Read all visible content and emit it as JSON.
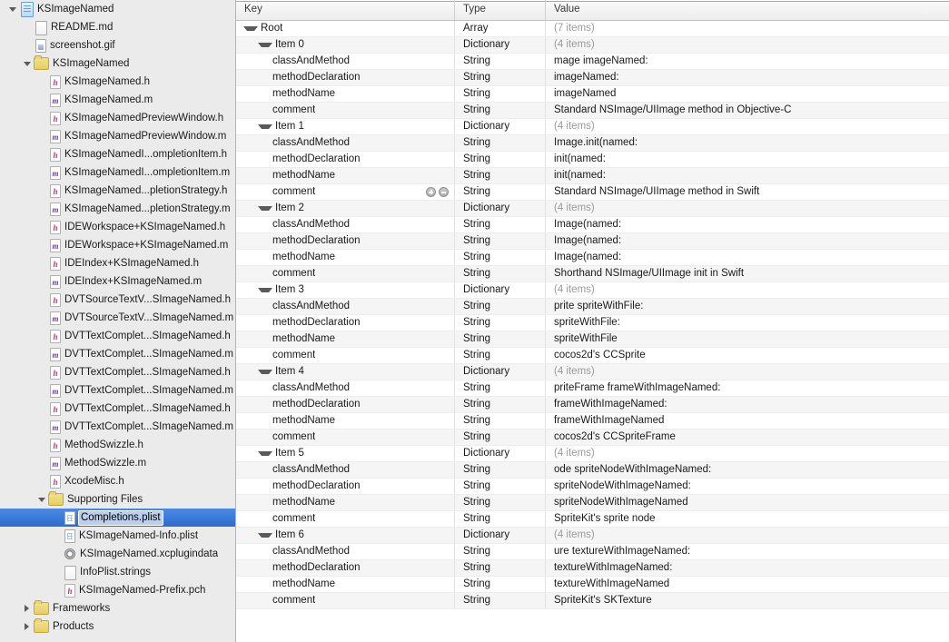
{
  "sidebar": {
    "name": "project-navigator",
    "rows": [
      {
        "label": "KSImageNamed",
        "icon": "project-icon",
        "indent": 0,
        "disclosure": "open",
        "selected": false
      },
      {
        "label": "README.md",
        "icon": "document-icon",
        "indent": 1,
        "disclosure": "none",
        "selected": false
      },
      {
        "label": "screenshot.gif",
        "icon": "image-icon",
        "indent": 1,
        "disclosure": "none",
        "selected": false
      },
      {
        "label": "KSImageNamed",
        "icon": "folder-icon",
        "indent": 1,
        "disclosure": "open",
        "selected": false
      },
      {
        "label": "KSImageNamed.h",
        "icon": "header-file-icon",
        "indent": 2,
        "disclosure": "none",
        "selected": false
      },
      {
        "label": "KSImageNamed.m",
        "icon": "method-file-icon",
        "indent": 2,
        "disclosure": "none",
        "selected": false
      },
      {
        "label": "KSImageNamedPreviewWindow.h",
        "icon": "header-file-icon",
        "indent": 2,
        "disclosure": "none",
        "selected": false
      },
      {
        "label": "KSImageNamedPreviewWindow.m",
        "icon": "method-file-icon",
        "indent": 2,
        "disclosure": "none",
        "selected": false
      },
      {
        "label": "KSImageNamedI...ompletionItem.h",
        "icon": "header-file-icon",
        "indent": 2,
        "disclosure": "none",
        "selected": false
      },
      {
        "label": "KSImageNamedI...ompletionItem.m",
        "icon": "method-file-icon",
        "indent": 2,
        "disclosure": "none",
        "selected": false
      },
      {
        "label": "KSImageNamed...pletionStrategy.h",
        "icon": "header-file-icon",
        "indent": 2,
        "disclosure": "none",
        "selected": false
      },
      {
        "label": "KSImageNamed...pletionStrategy.m",
        "icon": "method-file-icon",
        "indent": 2,
        "disclosure": "none",
        "selected": false
      },
      {
        "label": "IDEWorkspace+KSImageNamed.h",
        "icon": "header-file-icon",
        "indent": 2,
        "disclosure": "none",
        "selected": false
      },
      {
        "label": "IDEWorkspace+KSImageNamed.m",
        "icon": "method-file-icon",
        "indent": 2,
        "disclosure": "none",
        "selected": false
      },
      {
        "label": "IDEIndex+KSImageNamed.h",
        "icon": "header-file-icon",
        "indent": 2,
        "disclosure": "none",
        "selected": false
      },
      {
        "label": "IDEIndex+KSImageNamed.m",
        "icon": "method-file-icon",
        "indent": 2,
        "disclosure": "none",
        "selected": false
      },
      {
        "label": "DVTSourceTextV...SImageNamed.h",
        "icon": "header-file-icon",
        "indent": 2,
        "disclosure": "none",
        "selected": false
      },
      {
        "label": "DVTSourceTextV...SImageNamed.m",
        "icon": "method-file-icon",
        "indent": 2,
        "disclosure": "none",
        "selected": false
      },
      {
        "label": "DVTTextComplet...SImageNamed.h",
        "icon": "header-file-icon",
        "indent": 2,
        "disclosure": "none",
        "selected": false
      },
      {
        "label": "DVTTextComplet...SImageNamed.m",
        "icon": "method-file-icon",
        "indent": 2,
        "disclosure": "none",
        "selected": false
      },
      {
        "label": "DVTTextComplet...SImageNamed.h",
        "icon": "header-file-icon",
        "indent": 2,
        "disclosure": "none",
        "selected": false
      },
      {
        "label": "DVTTextComplet...SImageNamed.m",
        "icon": "method-file-icon",
        "indent": 2,
        "disclosure": "none",
        "selected": false
      },
      {
        "label": "DVTTextComplet...SImageNamed.h",
        "icon": "header-file-icon",
        "indent": 2,
        "disclosure": "none",
        "selected": false
      },
      {
        "label": "DVTTextComplet...SImageNamed.m",
        "icon": "method-file-icon",
        "indent": 2,
        "disclosure": "none",
        "selected": false
      },
      {
        "label": "MethodSwizzle.h",
        "icon": "header-file-icon",
        "indent": 2,
        "disclosure": "none",
        "selected": false
      },
      {
        "label": "MethodSwizzle.m",
        "icon": "method-file-icon",
        "indent": 2,
        "disclosure": "none",
        "selected": false
      },
      {
        "label": "XcodeMisc.h",
        "icon": "header-file-icon",
        "indent": 2,
        "disclosure": "none",
        "selected": false
      },
      {
        "label": "Supporting Files",
        "icon": "folder-icon",
        "indent": 2,
        "disclosure": "open",
        "selected": false
      },
      {
        "label": "Completions.plist",
        "icon": "plist-icon",
        "indent": 3,
        "disclosure": "none",
        "selected": true
      },
      {
        "label": "KSImageNamed-Info.plist",
        "icon": "plist-icon",
        "indent": 3,
        "disclosure": "none",
        "selected": false
      },
      {
        "label": "KSImageNamed.xcplugindata",
        "icon": "gear-icon",
        "indent": 3,
        "disclosure": "none",
        "selected": false
      },
      {
        "label": "InfoPlist.strings",
        "icon": "document-icon",
        "indent": 3,
        "disclosure": "none",
        "selected": false
      },
      {
        "label": "KSImageNamed-Prefix.pch",
        "icon": "header-file-icon",
        "indent": 3,
        "disclosure": "none",
        "selected": false
      },
      {
        "label": "Frameworks",
        "icon": "folder-icon",
        "indent": 1,
        "disclosure": "closed",
        "selected": false
      },
      {
        "label": "Products",
        "icon": "folder-icon",
        "indent": 1,
        "disclosure": "closed",
        "selected": false
      }
    ]
  },
  "editor": {
    "name": "plist-editor",
    "columns": {
      "key": "Key",
      "type": "Type",
      "value": "Value"
    },
    "rows": [
      {
        "key": "Root",
        "indent": 0,
        "disclosure": "open",
        "type": "Array",
        "value": "(7 items)",
        "muted": true,
        "buttons": false
      },
      {
        "key": "Item 0",
        "indent": 1,
        "disclosure": "open",
        "type": "Dictionary",
        "value": "(4 items)",
        "muted": true,
        "buttons": false
      },
      {
        "key": "classAndMethod",
        "indent": 2,
        "disclosure": "none",
        "type": "String",
        "value": "mage imageNamed:",
        "muted": false,
        "buttons": false
      },
      {
        "key": "methodDeclaration",
        "indent": 2,
        "disclosure": "none",
        "type": "String",
        "value": " imageNamed:",
        "muted": false,
        "buttons": false
      },
      {
        "key": "methodName",
        "indent": 2,
        "disclosure": "none",
        "type": "String",
        "value": "imageNamed",
        "muted": false,
        "buttons": false
      },
      {
        "key": "comment",
        "indent": 2,
        "disclosure": "none",
        "type": "String",
        "value": "Standard NSImage/UIImage method in Objective-C",
        "muted": false,
        "buttons": false
      },
      {
        "key": "Item 1",
        "indent": 1,
        "disclosure": "open",
        "type": "Dictionary",
        "value": "(4 items)",
        "muted": true,
        "buttons": false
      },
      {
        "key": "classAndMethod",
        "indent": 2,
        "disclosure": "none",
        "type": "String",
        "value": "Image.init(named:",
        "muted": false,
        "buttons": false
      },
      {
        "key": "methodDeclaration",
        "indent": 2,
        "disclosure": "none",
        "type": "String",
        "value": " init(named:",
        "muted": false,
        "buttons": false
      },
      {
        "key": "methodName",
        "indent": 2,
        "disclosure": "none",
        "type": "String",
        "value": "init(named:",
        "muted": false,
        "buttons": false
      },
      {
        "key": "comment",
        "indent": 2,
        "disclosure": "none",
        "type": "String",
        "value": "Standard NSImage/UIImage method in Swift",
        "muted": false,
        "buttons": true
      },
      {
        "key": "Item 2",
        "indent": 1,
        "disclosure": "open",
        "type": "Dictionary",
        "value": "(4 items)",
        "muted": true,
        "buttons": false
      },
      {
        "key": "classAndMethod",
        "indent": 2,
        "disclosure": "none",
        "type": "String",
        "value": "Image(named:",
        "muted": false,
        "buttons": false
      },
      {
        "key": "methodDeclaration",
        "indent": 2,
        "disclosure": "none",
        "type": "String",
        "value": "Image(named:",
        "muted": false,
        "buttons": false
      },
      {
        "key": "methodName",
        "indent": 2,
        "disclosure": "none",
        "type": "String",
        "value": "Image(named:",
        "muted": false,
        "buttons": false
      },
      {
        "key": "comment",
        "indent": 2,
        "disclosure": "none",
        "type": "String",
        "value": "Shorthand NSImage/UIImage init in Swift",
        "muted": false,
        "buttons": false
      },
      {
        "key": "Item 3",
        "indent": 1,
        "disclosure": "open",
        "type": "Dictionary",
        "value": "(4 items)",
        "muted": true,
        "buttons": false
      },
      {
        "key": "classAndMethod",
        "indent": 2,
        "disclosure": "none",
        "type": "String",
        "value": "prite spriteWithFile:",
        "muted": false,
        "buttons": false
      },
      {
        "key": "methodDeclaration",
        "indent": 2,
        "disclosure": "none",
        "type": "String",
        "value": " spriteWithFile:",
        "muted": false,
        "buttons": false
      },
      {
        "key": "methodName",
        "indent": 2,
        "disclosure": "none",
        "type": "String",
        "value": "spriteWithFile",
        "muted": false,
        "buttons": false
      },
      {
        "key": "comment",
        "indent": 2,
        "disclosure": "none",
        "type": "String",
        "value": "cocos2d's CCSprite",
        "muted": false,
        "buttons": false
      },
      {
        "key": "Item 4",
        "indent": 1,
        "disclosure": "open",
        "type": "Dictionary",
        "value": "(4 items)",
        "muted": true,
        "buttons": false
      },
      {
        "key": "classAndMethod",
        "indent": 2,
        "disclosure": "none",
        "type": "String",
        "value": "priteFrame frameWithImageNamed:",
        "muted": false,
        "buttons": false
      },
      {
        "key": "methodDeclaration",
        "indent": 2,
        "disclosure": "none",
        "type": "String",
        "value": " frameWithImageNamed:",
        "muted": false,
        "buttons": false
      },
      {
        "key": "methodName",
        "indent": 2,
        "disclosure": "none",
        "type": "String",
        "value": "frameWithImageNamed",
        "muted": false,
        "buttons": false
      },
      {
        "key": "comment",
        "indent": 2,
        "disclosure": "none",
        "type": "String",
        "value": "cocos2d's CCSpriteFrame",
        "muted": false,
        "buttons": false
      },
      {
        "key": "Item 5",
        "indent": 1,
        "disclosure": "open",
        "type": "Dictionary",
        "value": "(4 items)",
        "muted": true,
        "buttons": false
      },
      {
        "key": "classAndMethod",
        "indent": 2,
        "disclosure": "none",
        "type": "String",
        "value": "ode spriteNodeWithImageNamed:",
        "muted": false,
        "buttons": false
      },
      {
        "key": "methodDeclaration",
        "indent": 2,
        "disclosure": "none",
        "type": "String",
        "value": " spriteNodeWithImageNamed:",
        "muted": false,
        "buttons": false
      },
      {
        "key": "methodName",
        "indent": 2,
        "disclosure": "none",
        "type": "String",
        "value": "spriteNodeWithImageNamed",
        "muted": false,
        "buttons": false
      },
      {
        "key": "comment",
        "indent": 2,
        "disclosure": "none",
        "type": "String",
        "value": "SpriteKit's sprite node",
        "muted": false,
        "buttons": false
      },
      {
        "key": "Item 6",
        "indent": 1,
        "disclosure": "open",
        "type": "Dictionary",
        "value": "(4 items)",
        "muted": true,
        "buttons": false
      },
      {
        "key": "classAndMethod",
        "indent": 2,
        "disclosure": "none",
        "type": "String",
        "value": "ure textureWithImageNamed:",
        "muted": false,
        "buttons": false
      },
      {
        "key": "methodDeclaration",
        "indent": 2,
        "disclosure": "none",
        "type": "String",
        "value": " textureWithImageNamed:",
        "muted": false,
        "buttons": false
      },
      {
        "key": "methodName",
        "indent": 2,
        "disclosure": "none",
        "type": "String",
        "value": "textureWithImageNamed",
        "muted": false,
        "buttons": false
      },
      {
        "key": "comment",
        "indent": 2,
        "disclosure": "none",
        "type": "String",
        "value": "SpriteKit's SKTexture",
        "muted": false,
        "buttons": false
      }
    ]
  },
  "colors": {
    "selection_blue": "#3875d7",
    "sidebar_bg": "#ebebeb",
    "row_alt": "#f5f5f5",
    "header_bg": "#ededed"
  }
}
